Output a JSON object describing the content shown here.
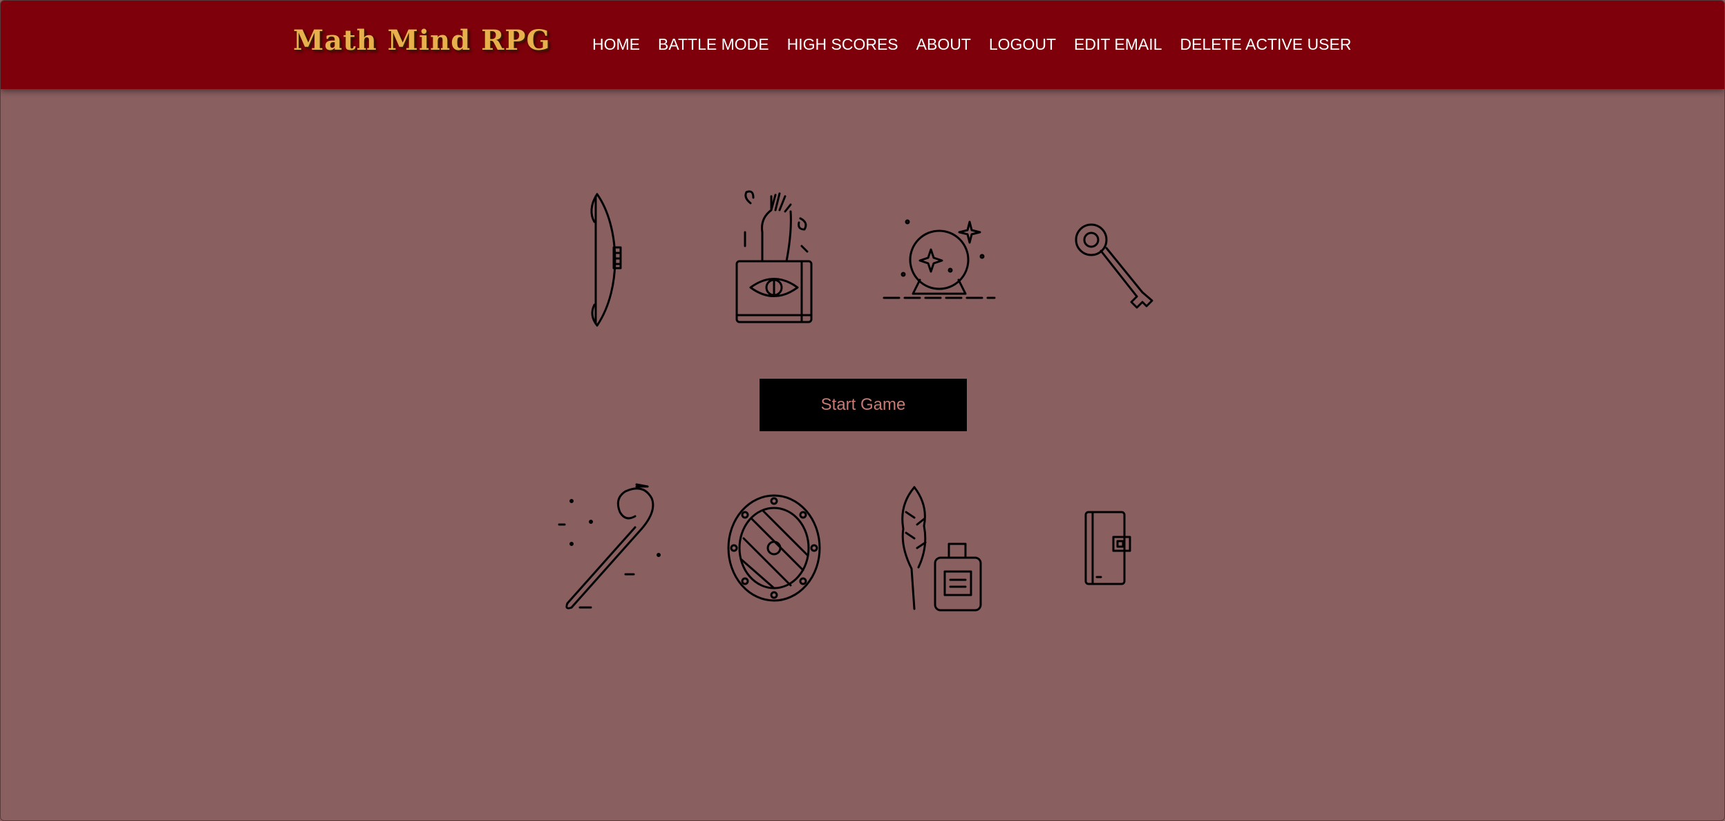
{
  "app": {
    "logo": "Math Mind RPG"
  },
  "nav": {
    "items": [
      {
        "label": "HOME",
        "name": "nav-home"
      },
      {
        "label": "BATTLE MODE",
        "name": "nav-battle-mode"
      },
      {
        "label": "HIGH SCORES",
        "name": "nav-high-scores"
      },
      {
        "label": "ABOUT",
        "name": "nav-about"
      },
      {
        "label": "LOGOUT",
        "name": "nav-logout"
      },
      {
        "label": "EDIT EMAIL",
        "name": "nav-edit-email"
      },
      {
        "label": "DELETE ACTIVE USER",
        "name": "nav-delete-active-user"
      }
    ]
  },
  "main": {
    "start_button_label": "Start Game",
    "icons_top": [
      "bow-icon",
      "spellbook-eye-icon",
      "crystal-ball-icon",
      "key-icon"
    ],
    "icons_bottom": [
      "staff-icon",
      "shield-icon",
      "quill-ink-icon",
      "book-icon"
    ]
  },
  "colors": {
    "background": "#895f60",
    "navbar": "#7e000a",
    "logo": "#e7b04c",
    "button_bg": "#000000",
    "button_text": "#c67a73"
  }
}
